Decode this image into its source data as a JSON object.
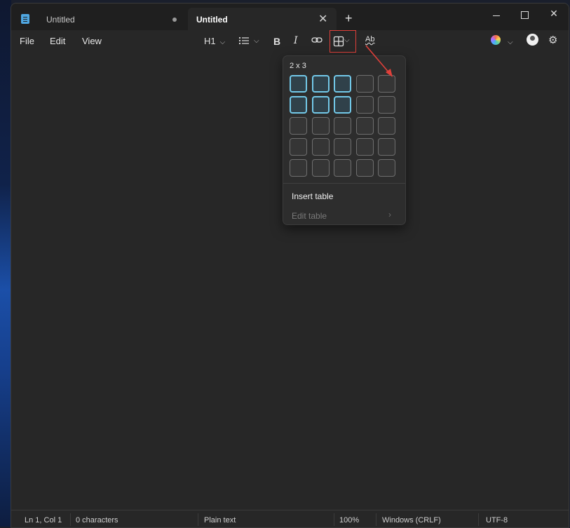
{
  "tabs": [
    {
      "label": "Untitled",
      "active": false,
      "unsaved": true
    },
    {
      "label": "Untitled",
      "active": true
    }
  ],
  "new_tab_label": "+",
  "window_controls": {
    "close_label": "✕"
  },
  "menu": {
    "file": "File",
    "edit": "Edit",
    "view": "View"
  },
  "toolbar": {
    "heading": "H1",
    "bold": "B",
    "italic": "I",
    "spellcheck": "Ab"
  },
  "table_popup": {
    "size_label": "2 x 3",
    "selected_rows": 2,
    "selected_cols": 3,
    "grid_rows": 5,
    "grid_cols": 5,
    "insert_label": "Insert table",
    "edit_label": "Edit table"
  },
  "status": {
    "position": "Ln 1, Col 1",
    "characters": "0 characters",
    "format": "Plain text",
    "zoom": "100%",
    "line_ending": "Windows (CRLF)",
    "encoding": "UTF-8"
  },
  "colors": {
    "accent": "#72c8e8",
    "highlight": "#e0403a"
  },
  "icons": [
    "notepad-icon",
    "list-icon",
    "link-icon",
    "table-icon",
    "spellcheck-icon",
    "copilot-icon",
    "avatar-icon",
    "gear-icon"
  ]
}
